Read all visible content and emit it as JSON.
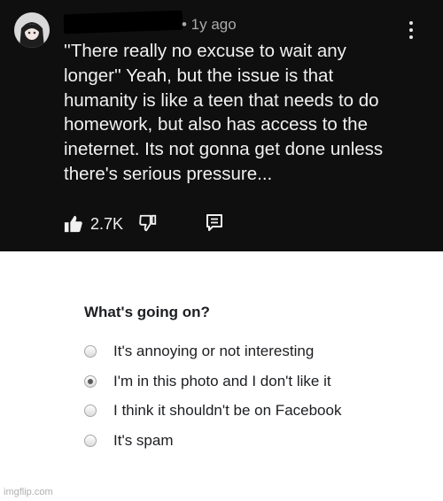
{
  "comment": {
    "time": "• 1y ago",
    "text": "''There really no excuse to wait any\nlonger'' Yeah, but the issue is that\nhumanity is like a teen that needs to do\nhomework, but also has access to the\nineternet. Its not gonna get done unless\nthere's serious pressure...",
    "likes": "2.7K",
    "icons": {
      "avatar": "anime-avatar-icon",
      "like": "thumbs-up-icon",
      "dislike": "thumbs-down-icon",
      "reply": "reply-icon",
      "more": "more-vertical-icon"
    },
    "colors": {
      "background": "#0f0f0f",
      "text": "#f1f1f1",
      "muted": "#aaaaaa"
    }
  },
  "report": {
    "title": "What's going on?",
    "options": [
      {
        "label": "It's annoying or not interesting",
        "selected": false
      },
      {
        "label": "I'm in this photo and I don't like it",
        "selected": true
      },
      {
        "label": "I think it shouldn't be on Facebook",
        "selected": false
      },
      {
        "label": "It's spam",
        "selected": false
      }
    ]
  },
  "watermark": "imgflip.com"
}
